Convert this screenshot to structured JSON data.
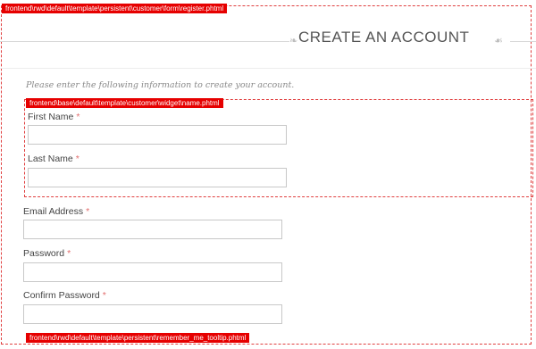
{
  "hints": {
    "register": "frontend\\rwd\\default\\template\\persistent\\customer\\form\\register.phtml",
    "name_widget": "frontend\\base\\default\\template\\customer\\widget\\name.phtml",
    "remember_me": "frontend\\rwd\\default\\template\\persistent\\remember_me_tooltip.phtml"
  },
  "page": {
    "title": "CREATE AN ACCOUNT",
    "intro": "Please enter the following information to create your account.",
    "required_marker": "*"
  },
  "form": {
    "first_name": {
      "label": "First Name",
      "value": ""
    },
    "last_name": {
      "label": "Last Name",
      "value": ""
    },
    "email": {
      "label": "Email Address",
      "value": ""
    },
    "password": {
      "label": "Password",
      "value": ""
    },
    "confirm_password": {
      "label": "Confirm Password",
      "value": ""
    }
  },
  "colors": {
    "hint_tag": "#e60000",
    "required": "#e26e6e"
  }
}
